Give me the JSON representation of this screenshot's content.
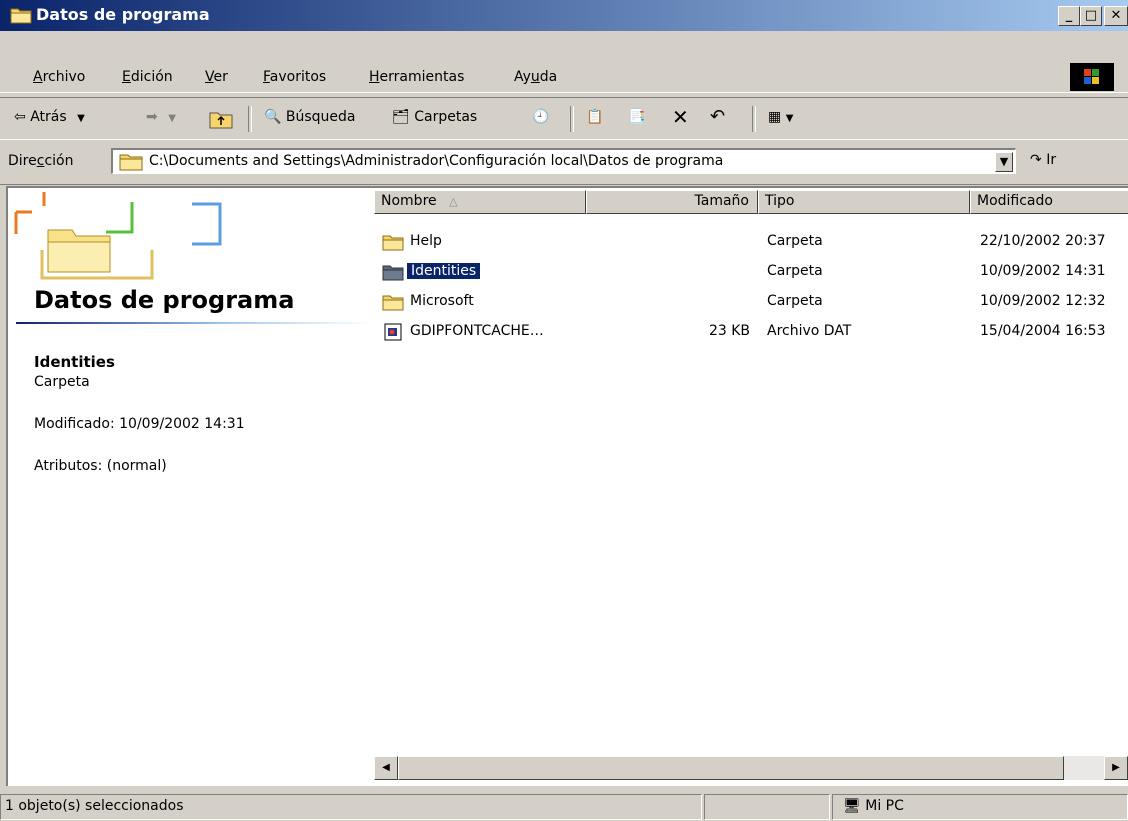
{
  "window": {
    "title": "Datos de programa"
  },
  "menu": {
    "items": [
      {
        "label": "Archivo",
        "key": "A",
        "rest": "rchivo"
      },
      {
        "label": "Edición",
        "key": "E",
        "rest": "dición"
      },
      {
        "label": "Ver",
        "key": "V",
        "rest": "er"
      },
      {
        "label": "Favoritos",
        "key": "F",
        "rest": "avoritos"
      },
      {
        "label": "Herramientas",
        "key": "H",
        "rest": "erramientas"
      },
      {
        "label": "Ayuda",
        "pre": "Ay",
        "key": "u",
        "rest": "da"
      }
    ]
  },
  "toolbar": {
    "back_label": "Atrás",
    "search_label": "Búsqueda",
    "folders_label": "Carpetas"
  },
  "address": {
    "label_pre": "Dire",
    "label_key": "c",
    "label_rest": "ción",
    "path": "C:\\Documents and Settings\\Administrador\\Configuración local\\Datos de programa",
    "go_label": "Ir"
  },
  "left_panel": {
    "title": "Datos de programa",
    "selected_name": "Identities",
    "selected_type": "Carpeta",
    "modified": "Modificado: 10/09/2002 14:31",
    "attributes": "Atributos: (normal)"
  },
  "columns": {
    "name": "Nombre",
    "size": "Tamaño",
    "type": "Tipo",
    "modified": "Modificado"
  },
  "files": [
    {
      "name": "Help",
      "size": "",
      "type": "Carpeta",
      "modified": "22/10/2002 20:37",
      "icon": "folder-icon"
    },
    {
      "name": "Identities",
      "size": "",
      "type": "Carpeta",
      "modified": "10/09/2002 14:31",
      "icon": "folder-icon",
      "selected": true
    },
    {
      "name": "Microsoft",
      "size": "",
      "type": "Carpeta",
      "modified": "10/09/2002 12:32",
      "icon": "folder-icon"
    },
    {
      "name": "GDIPFONTCACHE…",
      "size": "23 KB",
      "type": "Archivo DAT",
      "modified": "15/04/2004 16:53",
      "icon": "dat-file-icon"
    }
  ],
  "status": {
    "selection": "1 objeto(s) seleccionados",
    "zone": "Mi PC"
  },
  "colors": {
    "titlebar_start": "#0a246a",
    "titlebar_end": "#a6caf0",
    "selection": "#0a246a",
    "face": "#d4d0c8"
  }
}
